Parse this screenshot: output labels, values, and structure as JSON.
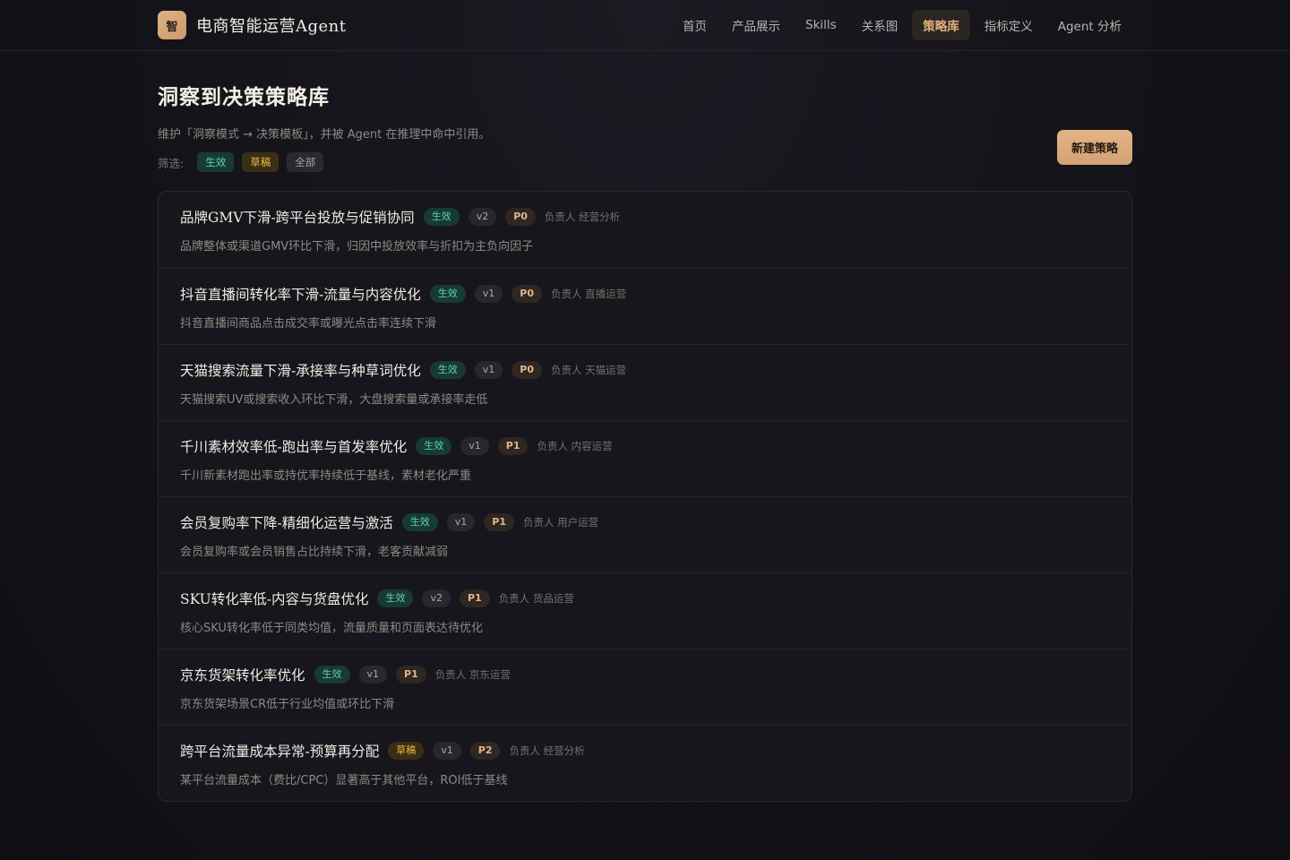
{
  "header": {
    "logo_text": "智",
    "app_title": "电商智能运营Agent",
    "nav": [
      {
        "label": "首页",
        "active": false
      },
      {
        "label": "产品展示",
        "active": false
      },
      {
        "label": "Skills",
        "active": false
      },
      {
        "label": "关系图",
        "active": false
      },
      {
        "label": "策略库",
        "active": true
      },
      {
        "label": "指标定义",
        "active": false
      },
      {
        "label": "Agent 分析",
        "active": false
      }
    ]
  },
  "page": {
    "title": "洞察到决策策略库",
    "subtitle": "维护「洞察模式 → 决策模板」，并被 Agent 在推理中命中引用。",
    "filter_label": "筛选:",
    "filters": [
      "生效",
      "草稿",
      "全部"
    ],
    "new_button": "新建策略"
  },
  "strategies": [
    {
      "title": "品牌GMV下滑-跨平台投放与促销协同",
      "status": "生效",
      "version": "v2",
      "priority": "P0",
      "owner": "负责人 经营分析",
      "desc": "品牌整体或渠道GMV环比下滑，归因中投放效率与折扣为主负向因子"
    },
    {
      "title": "抖音直播间转化率下滑-流量与内容优化",
      "status": "生效",
      "version": "v1",
      "priority": "P0",
      "owner": "负责人 直播运营",
      "desc": "抖音直播间商品点击成交率或曝光点击率连续下滑"
    },
    {
      "title": "天猫搜索流量下滑-承接率与种草词优化",
      "status": "生效",
      "version": "v1",
      "priority": "P0",
      "owner": "负责人 天猫运营",
      "desc": "天猫搜索UV或搜索收入环比下滑，大盘搜索量或承接率走低"
    },
    {
      "title": "千川素材效率低-跑出率与首发率优化",
      "status": "生效",
      "version": "v1",
      "priority": "P1",
      "owner": "负责人 内容运营",
      "desc": "千川新素材跑出率或持优率持续低于基线，素材老化严重"
    },
    {
      "title": "会员复购率下降-精细化运营与激活",
      "status": "生效",
      "version": "v1",
      "priority": "P1",
      "owner": "负责人 用户运营",
      "desc": "会员复购率或会员销售占比持续下滑，老客贡献减弱"
    },
    {
      "title": "SKU转化率低-内容与货盘优化",
      "status": "生效",
      "version": "v2",
      "priority": "P1",
      "owner": "负责人 货品运营",
      "desc": "核心SKU转化率低于同类均值，流量质量和页面表达待优化"
    },
    {
      "title": "京东货架转化率优化",
      "status": "生效",
      "version": "v1",
      "priority": "P1",
      "owner": "负责人 京东运营",
      "desc": "京东货架场景CR低于行业均值或环比下滑"
    },
    {
      "title": "跨平台流量成本异常-预算再分配",
      "status": "草稿",
      "version": "v1",
      "priority": "P2",
      "owner": "负责人 经营分析",
      "desc": "某平台流量成本（费比/CPC）显著高于其他平台，ROI低于基线"
    }
  ]
}
